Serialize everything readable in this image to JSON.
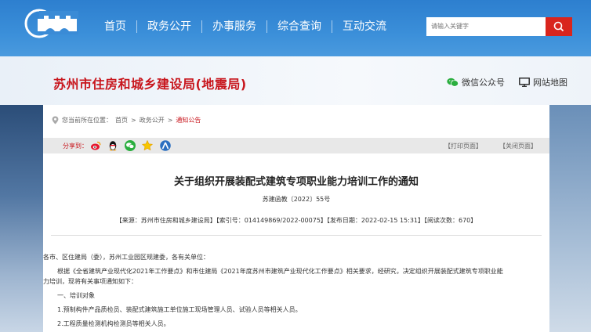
{
  "nav": {
    "items": [
      "首页",
      "政务公开",
      "办事服务",
      "综合查询",
      "互动交流"
    ]
  },
  "search": {
    "placeholder": "请输入关键字"
  },
  "site": {
    "title": "苏州市住房和城乡建设局(地震局)"
  },
  "header_links": {
    "wechat": "微信公众号",
    "sitemap": "网站地图"
  },
  "breadcrumb": {
    "prefix": "您当前所在位置：",
    "home": "首页",
    "sep1": ">",
    "section": "政务公开",
    "sep2": ">",
    "current": "通知公告"
  },
  "share": {
    "label": "分享到："
  },
  "tools": {
    "print": "【打印页面】",
    "close": "【关闭页面】"
  },
  "article": {
    "title": "关于组织开展装配式建筑专项职业能力培训工作的通知",
    "doc_no": "苏建函教〔2022〕55号",
    "meta": "【来源：苏州市住房和城乡建设局】【索引号：014149869/2022-00075】【发布日期：2022-02-15 15:31】【阅读次数：670】",
    "p1": "各市、区住建局（委），苏州工业园区规建委，各有关单位：",
    "p2a": "根据《全省建筑产业现代化2021年工作要点》和市住建局《2021年度苏州市建筑产业现代化工作要点》相关要求，经研究，决定组织开展装配式建筑专项职业能",
    "p2b": "力培训，现将有关事项通知如下：",
    "p3": "一、培训对象",
    "p4": "1.预制构件产品质检员、装配式建筑施工单位施工现场管理人员、试验人员等相关人员。",
    "p5": "2.工程质量检测机构检测员等相关人员。"
  },
  "colors": {
    "nav_bg": "#2d7fcf",
    "brand_red": "#c8161d",
    "search_btn": "#d9251d"
  }
}
